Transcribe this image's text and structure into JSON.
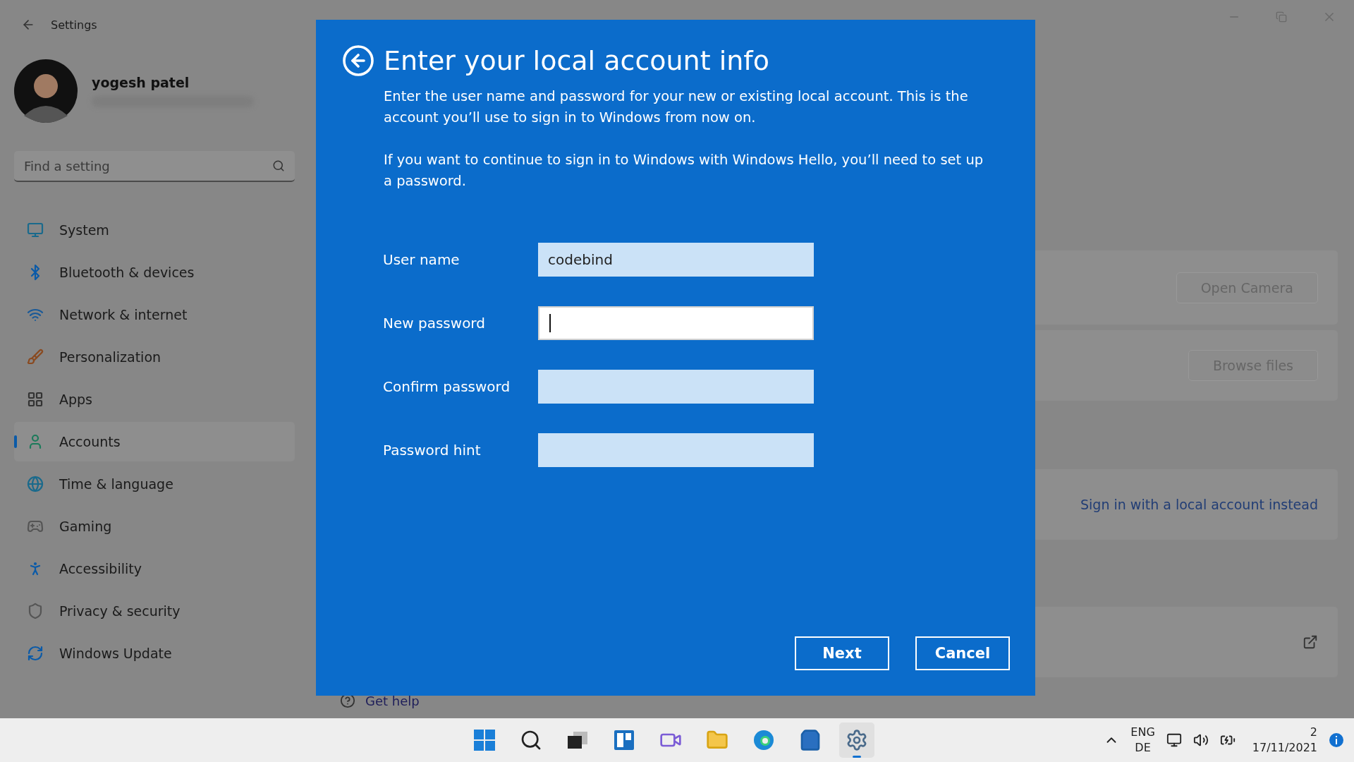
{
  "window": {
    "title": "Settings"
  },
  "profile": {
    "name": "yogesh patel"
  },
  "search": {
    "placeholder": "Find a setting"
  },
  "nav": [
    {
      "label": "System",
      "kind": "system",
      "selected": false
    },
    {
      "label": "Bluetooth & devices",
      "kind": "bluetooth",
      "selected": false
    },
    {
      "label": "Network & internet",
      "kind": "network",
      "selected": false
    },
    {
      "label": "Personalization",
      "kind": "brush",
      "selected": false
    },
    {
      "label": "Apps",
      "kind": "apps",
      "selected": false
    },
    {
      "label": "Accounts",
      "kind": "accounts",
      "selected": true
    },
    {
      "label": "Time & language",
      "kind": "time",
      "selected": false
    },
    {
      "label": "Gaming",
      "kind": "gaming",
      "selected": false
    },
    {
      "label": "Accessibility",
      "kind": "accessibility",
      "selected": false
    },
    {
      "label": "Privacy & security",
      "kind": "privacy",
      "selected": false
    },
    {
      "label": "Windows Update",
      "kind": "update",
      "selected": false
    }
  ],
  "content": {
    "cards": [
      {
        "kind": "button",
        "label": "Open Camera"
      },
      {
        "kind": "button",
        "label": "Browse files"
      },
      {
        "kind": "link",
        "label": "Sign in with a local account instead"
      },
      {
        "kind": "external"
      }
    ],
    "help_link": "Get help"
  },
  "dialog": {
    "title": "Enter your local account info",
    "paragraphs": [
      "Enter the user name and password for your new or existing local account. This is the account you’ll use to sign in to Windows from now on.",
      "If you want to continue to sign in to Windows with Windows Hello, you’ll need to set up a password."
    ],
    "fields": [
      {
        "label": "User name",
        "value": "codebind",
        "focused": false
      },
      {
        "label": "New password",
        "focused": true
      },
      {
        "label": "Confirm password",
        "focused": false
      },
      {
        "label": "Password hint",
        "focused": false
      }
    ],
    "buttons": [
      "Next",
      "Cancel"
    ]
  },
  "taskbar": {
    "apps": [
      {
        "kind": "start",
        "selected": false
      },
      {
        "kind": "search",
        "selected": false
      },
      {
        "kind": "taskview",
        "selected": false
      },
      {
        "kind": "widgets",
        "selected": false
      },
      {
        "kind": "chat",
        "selected": false
      },
      {
        "kind": "explorer",
        "selected": false
      },
      {
        "kind": "edge",
        "selected": false
      },
      {
        "kind": "store",
        "selected": false
      },
      {
        "kind": "settings",
        "selected": true
      }
    ],
    "language": [
      "ENG",
      "DE"
    ],
    "time": "2",
    "date": "17/11/2021"
  }
}
